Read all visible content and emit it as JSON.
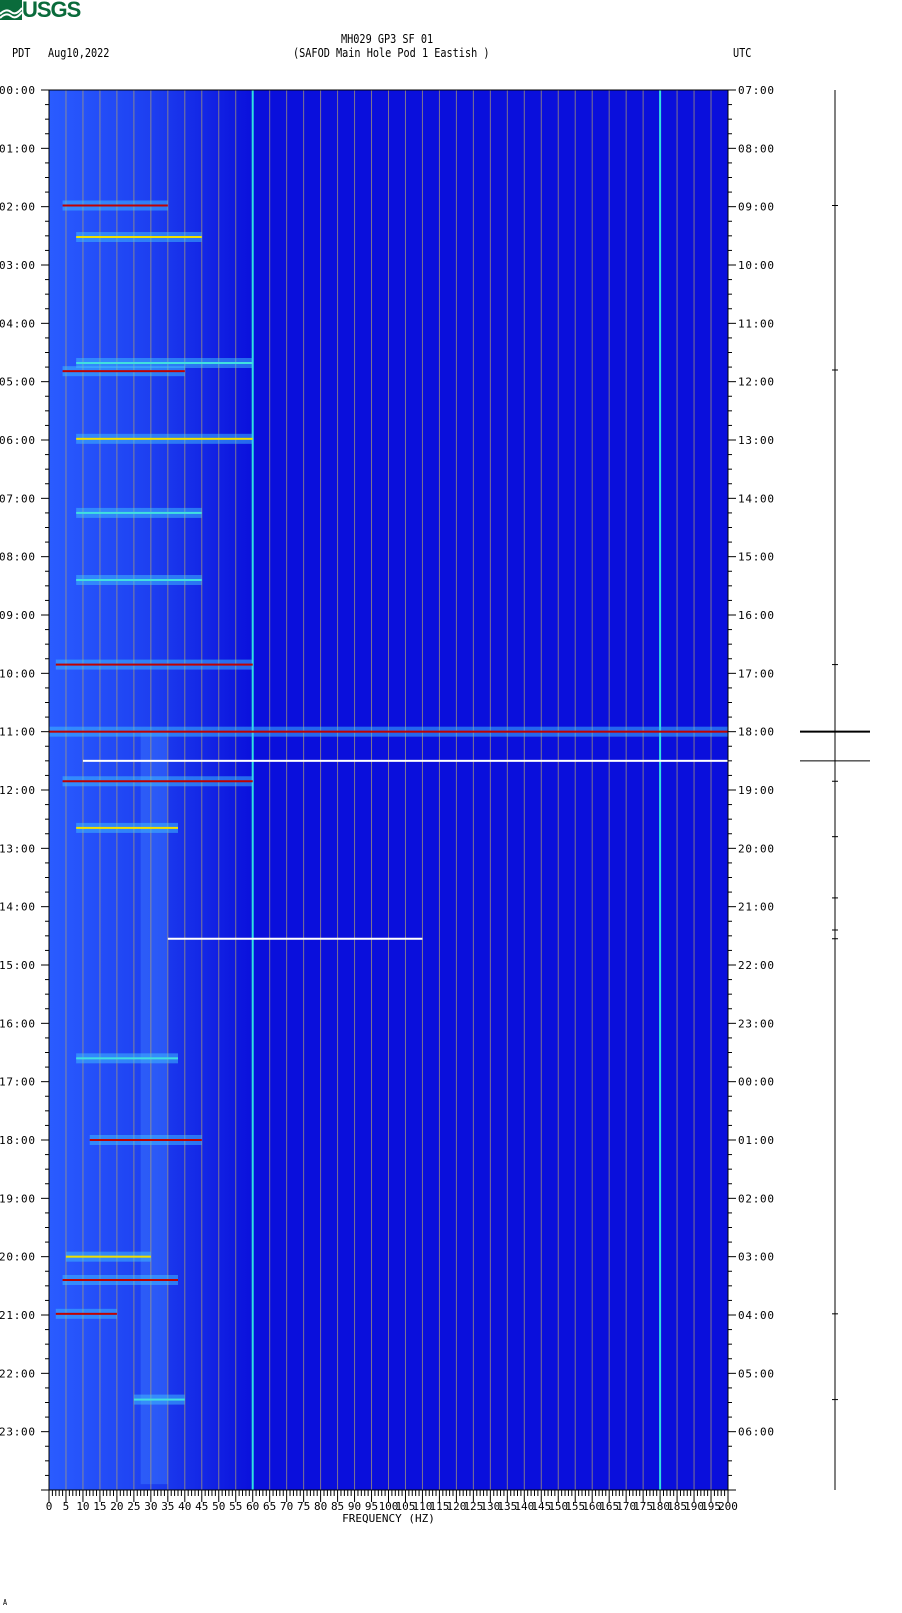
{
  "header": {
    "logo": "USGS",
    "title": "MH029 GP3 SF 01",
    "subtitle": "(SAFOD Main Hole Pod 1 Eastish )",
    "left_tz": "PDT",
    "date": "Aug10,2022",
    "right_tz": "UTC"
  },
  "footer_mark": "A",
  "chart_data": {
    "type": "heatmap",
    "title": "MH029 GP3 SF 01",
    "xlabel": "FREQUENCY (HZ)",
    "xlim": [
      0,
      200
    ],
    "x_ticks": [
      0,
      5,
      10,
      15,
      20,
      25,
      30,
      35,
      40,
      45,
      50,
      55,
      60,
      65,
      70,
      75,
      80,
      85,
      90,
      95,
      100,
      105,
      110,
      115,
      120,
      125,
      130,
      135,
      140,
      145,
      150,
      155,
      160,
      165,
      170,
      175,
      180,
      185,
      190,
      195,
      200
    ],
    "y_left_labels": [
      "00:00",
      "01:00",
      "02:00",
      "03:00",
      "04:00",
      "05:00",
      "06:00",
      "07:00",
      "08:00",
      "09:00",
      "10:00",
      "11:00",
      "12:00",
      "13:00",
      "14:00",
      "15:00",
      "16:00",
      "17:00",
      "18:00",
      "19:00",
      "20:00",
      "21:00",
      "22:00",
      "23:00"
    ],
    "y_right_labels": [
      "07:00",
      "08:00",
      "09:00",
      "10:00",
      "11:00",
      "12:00",
      "13:00",
      "14:00",
      "15:00",
      "16:00",
      "17:00",
      "18:00",
      "19:00",
      "20:00",
      "21:00",
      "22:00",
      "23:00",
      "00:00",
      "01:00",
      "02:00",
      "03:00",
      "04:00",
      "05:00",
      "06:00"
    ],
    "ylim_hours": [
      0,
      24
    ],
    "constant_lines_hz": [
      60,
      180
    ],
    "events": [
      {
        "hour": 1.98,
        "fmin": 4,
        "fmax": 35,
        "level": "red"
      },
      {
        "hour": 2.52,
        "fmin": 8,
        "fmax": 45,
        "level": "yellow"
      },
      {
        "hour": 4.68,
        "fmin": 8,
        "fmax": 60,
        "level": "cyan"
      },
      {
        "hour": 4.82,
        "fmin": 4,
        "fmax": 40,
        "level": "red"
      },
      {
        "hour": 5.98,
        "fmin": 8,
        "fmax": 60,
        "level": "yellow"
      },
      {
        "hour": 7.25,
        "fmin": 8,
        "fmax": 45,
        "level": "cyan"
      },
      {
        "hour": 8.4,
        "fmin": 8,
        "fmax": 45,
        "level": "cyan"
      },
      {
        "hour": 9.85,
        "fmin": 2,
        "fmax": 60,
        "level": "red"
      },
      {
        "hour": 11.0,
        "fmin": 0,
        "fmax": 200,
        "level": "red"
      },
      {
        "hour": 11.5,
        "fmin": 10,
        "fmax": 200,
        "level": "white"
      },
      {
        "hour": 11.85,
        "fmin": 4,
        "fmax": 60,
        "level": "red"
      },
      {
        "hour": 12.65,
        "fmin": 8,
        "fmax": 38,
        "level": "yellow"
      },
      {
        "hour": 14.55,
        "fmin": 35,
        "fmax": 110,
        "level": "white"
      },
      {
        "hour": 16.6,
        "fmin": 8,
        "fmax": 38,
        "level": "cyan"
      },
      {
        "hour": 18.0,
        "fmin": 12,
        "fmax": 45,
        "level": "red"
      },
      {
        "hour": 20.0,
        "fmin": 5,
        "fmax": 30,
        "level": "yellow"
      },
      {
        "hour": 20.4,
        "fmin": 4,
        "fmax": 38,
        "level": "red"
      },
      {
        "hour": 20.98,
        "fmin": 2,
        "fmax": 20,
        "level": "red"
      },
      {
        "hour": 22.45,
        "fmin": 25,
        "fmax": 40,
        "level": "cyan"
      }
    ],
    "trace_spikes_hours": [
      1.98,
      4.8,
      9.85,
      11.0,
      11.5,
      11.85,
      12.8,
      13.85,
      14.4,
      14.55,
      20.98,
      22.45
    ]
  }
}
